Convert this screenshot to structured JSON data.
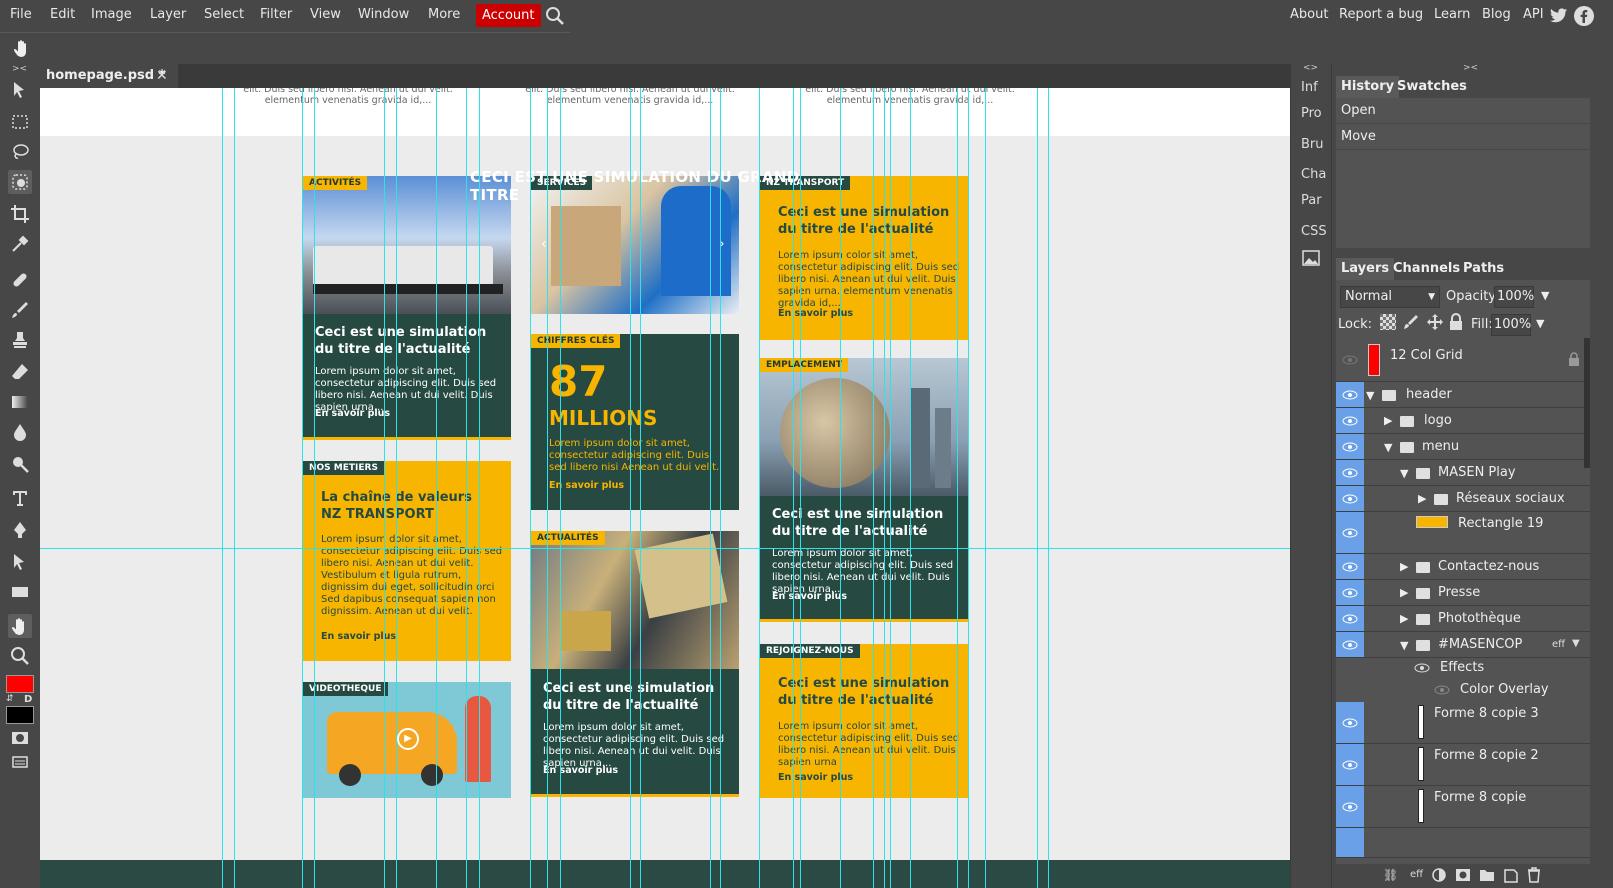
{
  "menubar": {
    "items": [
      "File",
      "Edit",
      "Image",
      "Layer",
      "Select",
      "Filter",
      "View",
      "Window",
      "More"
    ],
    "account": "Account",
    "right": [
      "About",
      "Report a bug",
      "Learn",
      "Blog",
      "API"
    ]
  },
  "document": {
    "tab_title": "homepage.psd *"
  },
  "canvas": {
    "top_texts": [
      "elit. Duis sed libero nisi. Aenean ut dui velit. elementum venenatis gravida id,...",
      "elit. Duis sed libero nisi. Aenean ut dui velit. elementum venenatis gravida id,...",
      "elit. Duis sed libero nisi. Aenean ut dui velit. elementum venenatis gravida id,..."
    ],
    "big_title": "CECI EST UNE SIMULATION DU GRAND TITRE",
    "cards": {
      "activites": {
        "tag": "ACTIVITÉS",
        "title1": "Ceci est une simulation",
        "title2": "du titre de l'actualité",
        "body": "Lorem ipsum dolor sit amet, consectetur adipiscing elit. Duis sed libero nisi. Aenean ut dui velit. Duis sapien urna...",
        "link": "En savoir plus"
      },
      "services": {
        "tag": "SERVICES"
      },
      "nztransport": {
        "tag": "NZ TRANSPORT",
        "title1": "Ceci est une simulation",
        "title2": "du titre de l'actualité",
        "body": "Lorem ipsum color sit amet, consectetur adipiscing elit. Duis sed libero nisi. Aenean ut dui velit. Duis sapien urna. elementum venenatis gravida id,...",
        "link": "En savoir plus"
      },
      "chiffres": {
        "tag": "CHIFFRES CLÉS",
        "number": "87",
        "unit": "MILLIONS",
        "body": "Lorem ipsum dolor sit amet, consectetur adipiscing elit. Duis sed libero nisi Aenean ut dui velit.",
        "link": "En savoir plus"
      },
      "emplacement": {
        "tag": "EMPLACEMENT",
        "title1": "Ceci est une simulation",
        "title2": "du titre de l'actualité",
        "body": "Lorem ipsum dolor sit amet, consectetur adipiscing elit. Duis sed libero nisi. Aenean ut dui velit. Duis sapien urna...",
        "link": "En savoir plus"
      },
      "metiers": {
        "tag": "NOS METIERS",
        "title1": "La chaîne de valeurs",
        "title2": "NZ TRANSPORT",
        "body": "Lorem ipsum dolor sit amet, consectetur adipiscing elit. Duis sed libero nisi. Aenean ut dui velit. Vestibulum et ligula rutrum, dignissim dui eget, sollicitudin orci Sed dapibus consequat sapien non dignissim. Aenean ut dui velit.",
        "link": "En savoir plus"
      },
      "actualites": {
        "tag": "ACTUALITÉS",
        "title1": "Ceci est une simulation",
        "title2": "du titre de l'actualité",
        "body": "Lorem ipsum dolor sit amet, consectetur adipiscing elit. Duis sed libero nisi. Aenean ut dui velit. Duis sapien urna...",
        "link": "En savoir plus"
      },
      "rejoignez": {
        "tag": "REJOIGNEZ-NOUS",
        "title1": "Ceci est une simulation",
        "title2": "du titre de l'actualité",
        "body": "Lorem ipsum color sit amet, consectetur adipiscing elit. Duis sed libero nisi. Aenean ut dui velit. Duis sapien urna",
        "link": "En savoir plus"
      },
      "videotheque": {
        "tag": "VIDEOTHEQUE"
      }
    },
    "colors": {
      "yellow": "#f7b500",
      "dark_green": "#264a42",
      "guide": "#2de2e8"
    }
  },
  "mini_panels": [
    "Inf",
    "Pro",
    "Bru",
    "Cha",
    "Par",
    "CSS"
  ],
  "history": {
    "tabs": [
      "History",
      "Swatches"
    ],
    "items": [
      "Open",
      "Move"
    ]
  },
  "layers": {
    "tabs": [
      "Layers",
      "Channels",
      "Paths"
    ],
    "blend_mode": "Normal",
    "opacity_label": "Opacity:",
    "opacity": "100%",
    "lock_label": "Lock:",
    "fill_label": "Fill:",
    "fill": "100%",
    "items": [
      {
        "name": "12 Col Grid"
      },
      {
        "name": "header"
      },
      {
        "name": "logo"
      },
      {
        "name": "menu"
      },
      {
        "name": "MASEN Play"
      },
      {
        "name": "Réseaux sociaux"
      },
      {
        "name": "Rectangle 19"
      },
      {
        "name": "Contactez-nous"
      },
      {
        "name": "Presse"
      },
      {
        "name": "Photothèque"
      },
      {
        "name": "#MASENCOP",
        "badge": "eff"
      },
      {
        "name": "Effects"
      },
      {
        "name": "Color Overlay"
      },
      {
        "name": "Forme 8 copie 3"
      },
      {
        "name": "Forme 8 copie 2"
      },
      {
        "name": "Forme 8 copie"
      }
    ],
    "footer_eff": "eff"
  }
}
